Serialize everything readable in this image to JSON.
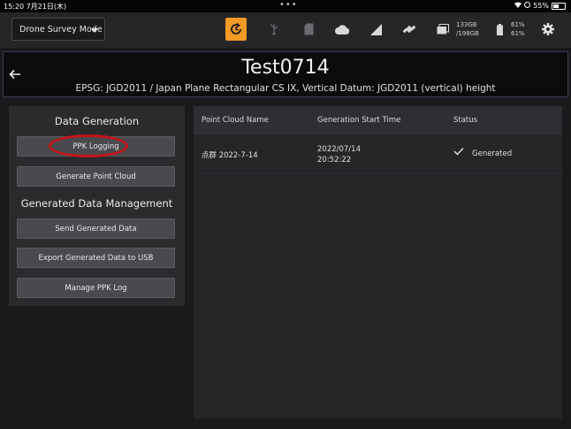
{
  "statusbar": {
    "time": "15:20  7月21日(木)",
    "dots": "•••",
    "battery": "55%"
  },
  "toolbar": {
    "mode_label": "Drone Survey Mode",
    "storage_line1": "133GB",
    "storage_line2": "/198GB",
    "battery_line1": "61%",
    "battery_line2": "61%",
    "accent_color": "#f19a25"
  },
  "banner": {
    "title": "Test0714",
    "subtitle": "EPSG: JGD2011 / Japan Plane Rectangular CS IX, Vertical Datum: JGD2011 (vertical) height"
  },
  "left_panel": {
    "data_generation_title": "Data Generation",
    "ppk_logging": "PPK Logging",
    "generate_point_cloud": "Generate Point Cloud",
    "management_title": "Generated Data Management",
    "send_generated_data": "Send Generated Data",
    "export_usb": "Export Generated Data to USB",
    "manage_ppk_log": "Manage PPK Log"
  },
  "table": {
    "columns": [
      "Point Cloud Name",
      "Generation Start Time",
      "Status"
    ],
    "rows": [
      {
        "name": "点群 2022-7-14",
        "date": "2022/07/14",
        "time": "20:52:22",
        "status": "Generated"
      }
    ]
  }
}
